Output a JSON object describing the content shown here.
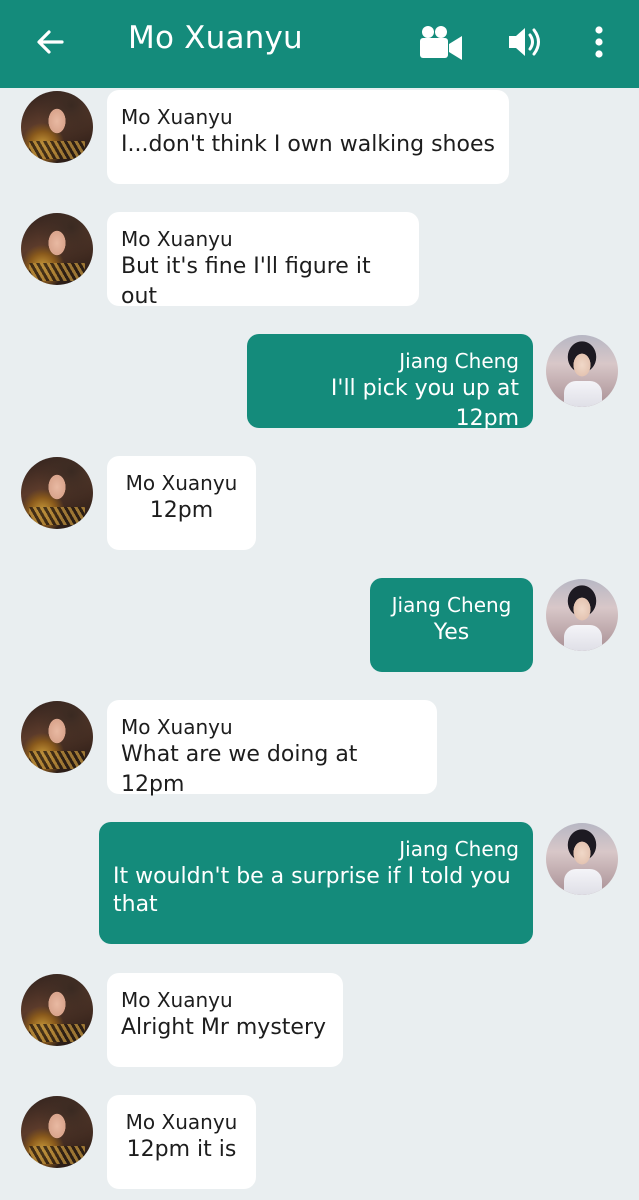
{
  "header": {
    "title": "Mo Xuanyu",
    "back_icon": "arrow-left-icon",
    "video_icon": "video-camera-icon",
    "volume_icon": "speaker-icon",
    "more_icon": "more-vertical-icon",
    "bar_color": "#148b7b"
  },
  "colors": {
    "outgoing_bubble": "#148b7b",
    "incoming_bubble": "#ffffff",
    "background": "#e9eef0"
  },
  "messages": [
    {
      "sender": "Mo Xuanyu",
      "text": "I...don't think I own walking shoes",
      "side": "left"
    },
    {
      "sender": "Mo Xuanyu",
      "text": "But it's fine I'll figure it out",
      "side": "left"
    },
    {
      "sender": "Jiang Cheng",
      "text": "I'll pick you up at 12pm",
      "side": "right"
    },
    {
      "sender": "Mo Xuanyu",
      "text": "12pm",
      "side": "left"
    },
    {
      "sender": "Jiang Cheng",
      "text": "Yes",
      "side": "right"
    },
    {
      "sender": "Mo Xuanyu",
      "text": "What are we doing at 12pm",
      "side": "left"
    },
    {
      "sender": "Jiang Cheng",
      "text_line1": "It wouldn't be a surprise if I told you",
      "text_line2": "that",
      "side": "right"
    },
    {
      "sender": "Mo Xuanyu",
      "text": "Alright Mr mystery",
      "side": "left"
    },
    {
      "sender": "Mo Xuanyu",
      "text": "12pm it is",
      "side": "left"
    }
  ]
}
